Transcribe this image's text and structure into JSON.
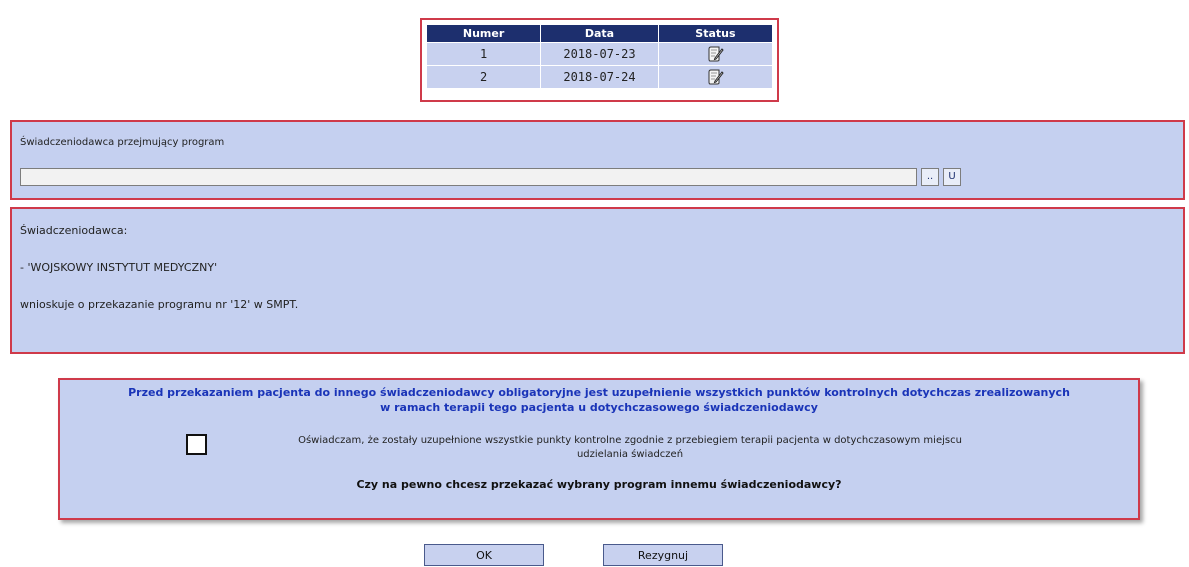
{
  "table": {
    "headers": [
      "Numer",
      "Data",
      "Status"
    ],
    "rows": [
      {
        "numer": "1",
        "data": "2018-07-23",
        "status_icon": "edit-note-icon"
      },
      {
        "numer": "2",
        "data": "2018-07-24",
        "status_icon": "edit-note-icon"
      }
    ]
  },
  "provider": {
    "label": "Świadczeniodawca przejmujący program",
    "value": "",
    "browse_label": "..",
    "clear_label": "U"
  },
  "info": {
    "line1": "Świadczeniodawca:",
    "line2": "- 'WOJSKOWY INSTYTUT MEDYCZNY'",
    "line3": "wnioskuje o przekazanie programu nr '12' w SMPT."
  },
  "confirm": {
    "warning_line1": "Przed przekazaniem pacjenta do innego świadczeniodawcy obligatoryjne jest uzupełnienie wszystkich punktów kontrolnych dotychczas zrealizowanych",
    "warning_line2": "w ramach terapii tego pacjenta u dotychczasowego świadczeniodawcy",
    "declaration_line1": "Oświadczam, że zostały uzupełnione wszystkie punkty kontrolne zgodnie z przebiegiem terapii pacjenta w dotychczasowym miejscu",
    "declaration_line2": "udzielania świadczeń",
    "checked": false,
    "question": "Czy na pewno chcesz przekazać wybrany program innemu świadczeniodawcy?"
  },
  "buttons": {
    "ok": "OK",
    "cancel": "Rezygnuj"
  },
  "colors": {
    "header_bg": "#1d2f6e",
    "panel_bg": "#c5d0f0",
    "panel_border": "#cf3a4a",
    "warning_text": "#1a34b8"
  }
}
